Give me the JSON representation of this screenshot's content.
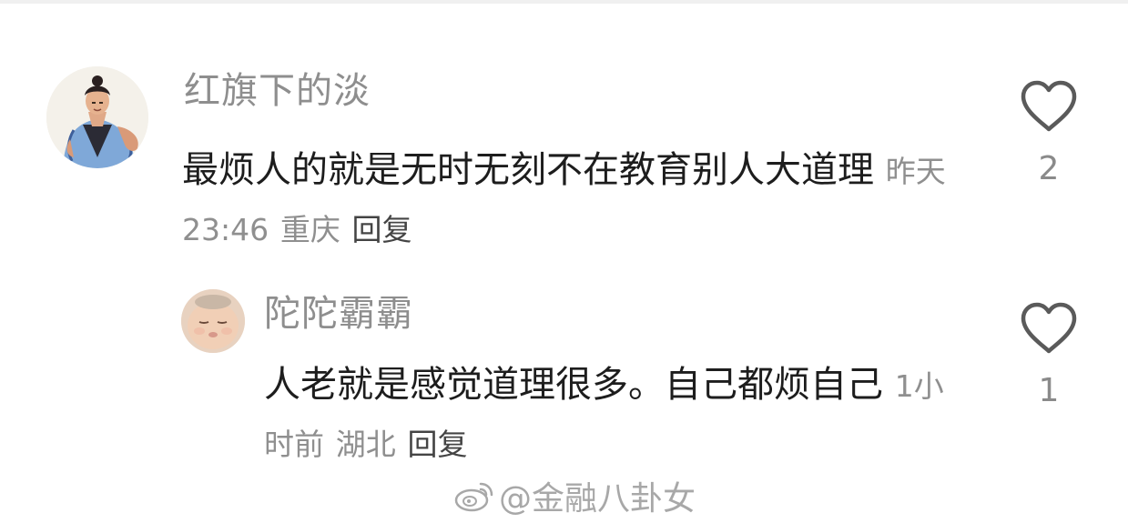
{
  "comments": [
    {
      "username": "红旗下的淡",
      "text": "最烦人的就是无时无刻不在教育别人大道理",
      "time": "昨天 23:46",
      "location": "重庆",
      "reply_label": "回复",
      "like_count": "2",
      "avatar": "avatar-illustrated-figure",
      "like_icon": "heart-icon"
    },
    {
      "username": "陀陀霸霸",
      "text": "人老就是感觉道理很多。自己都烦自己",
      "time": "1小时前",
      "location": "湖北",
      "reply_label": "回复",
      "like_count": "1",
      "avatar": "avatar-baby-photo",
      "like_icon": "heart-icon"
    }
  ],
  "watermark": {
    "text": "@金融八卦女",
    "icon": "weibo-logo-icon"
  },
  "colors": {
    "username": "#8e8e8e",
    "comment_text": "#1d1d1d",
    "meta": "#8f8f8f",
    "icon": "#5a5a5a"
  }
}
